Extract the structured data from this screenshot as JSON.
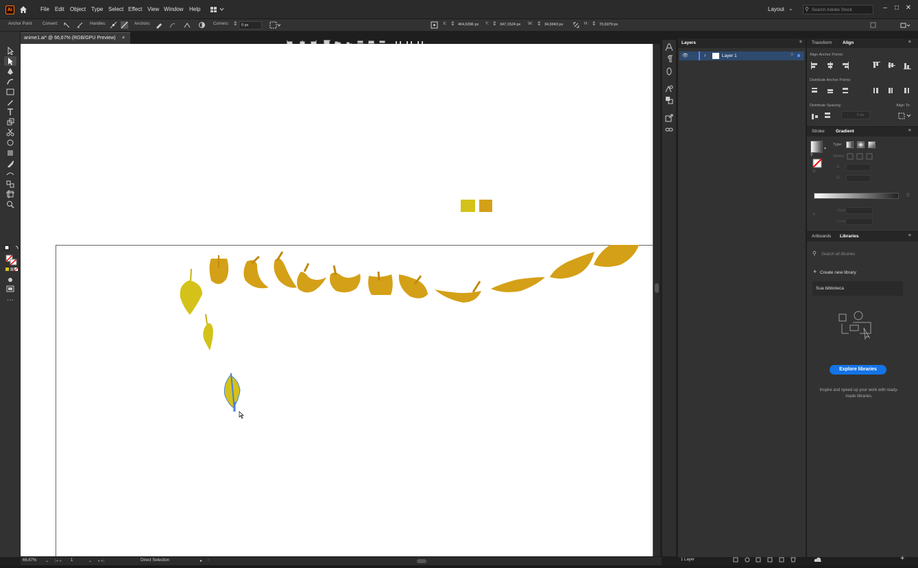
{
  "app": {
    "logo_text": "Ai"
  },
  "menu": [
    "File",
    "Edit",
    "Object",
    "Type",
    "Select",
    "Effect",
    "View",
    "Window",
    "Help"
  ],
  "workspace": {
    "label": "Layout",
    "search_placeholder": "Search Adobe Stock"
  },
  "control_bar": {
    "tool_name": "Anchor Point",
    "convert_label": "Convert:",
    "handles_label": "Handles:",
    "anchors_label": "Anchors:",
    "corners_label": "Corners:",
    "corners_value": "0 px",
    "x_label": "X:",
    "x_value": "404,6396 px",
    "y_label": "Y:",
    "y_value": "347,1524 px",
    "w_label": "W:",
    "w_value": "34,6943 px",
    "h_label": "H:",
    "h_value": "70,6979 px"
  },
  "document_tab": {
    "title": "anime1.ai* @ 66,67% (RGB/GPU Preview)",
    "close": "×"
  },
  "layers_panel": {
    "tab": "Layers",
    "layer_name": "Layer 1",
    "footer_count": "1 Layer"
  },
  "align_panel": {
    "tabs": [
      "Transform",
      "Align"
    ],
    "align_anchor_points": "Align Anchor Points:",
    "distribute_anchor_points": "Distribute Anchor Points:",
    "distribute_spacing": "Distribute Spacing:",
    "align_to": "Align To:",
    "spacing_value": "0 px"
  },
  "gradient_panel": {
    "tabs": [
      "Stroke",
      "Gradient"
    ],
    "type_label": "Type:",
    "stroke_label": "Stroke:",
    "opacity_label": "Opacity:",
    "location_label": "Location:"
  },
  "libraries_panel": {
    "tabs": [
      "Artboards",
      "Libraries"
    ],
    "search_placeholder": "Search all libraries",
    "create_new": "Create new library",
    "library_item": "Sua biblioteca",
    "promo_text": "Inspire and speed up your work with ready-made libraries.",
    "explore_button": "Explore libraries"
  },
  "status_bar": {
    "zoom": "66,67%",
    "artboard_number": "1",
    "tool": "Direct Selection"
  },
  "colors": {
    "leaf_yellow": "#d4c21a",
    "leaf_gold": "#d4a017",
    "selection_blue": "#4a7fe0",
    "accent_blue": "#1473e6"
  }
}
